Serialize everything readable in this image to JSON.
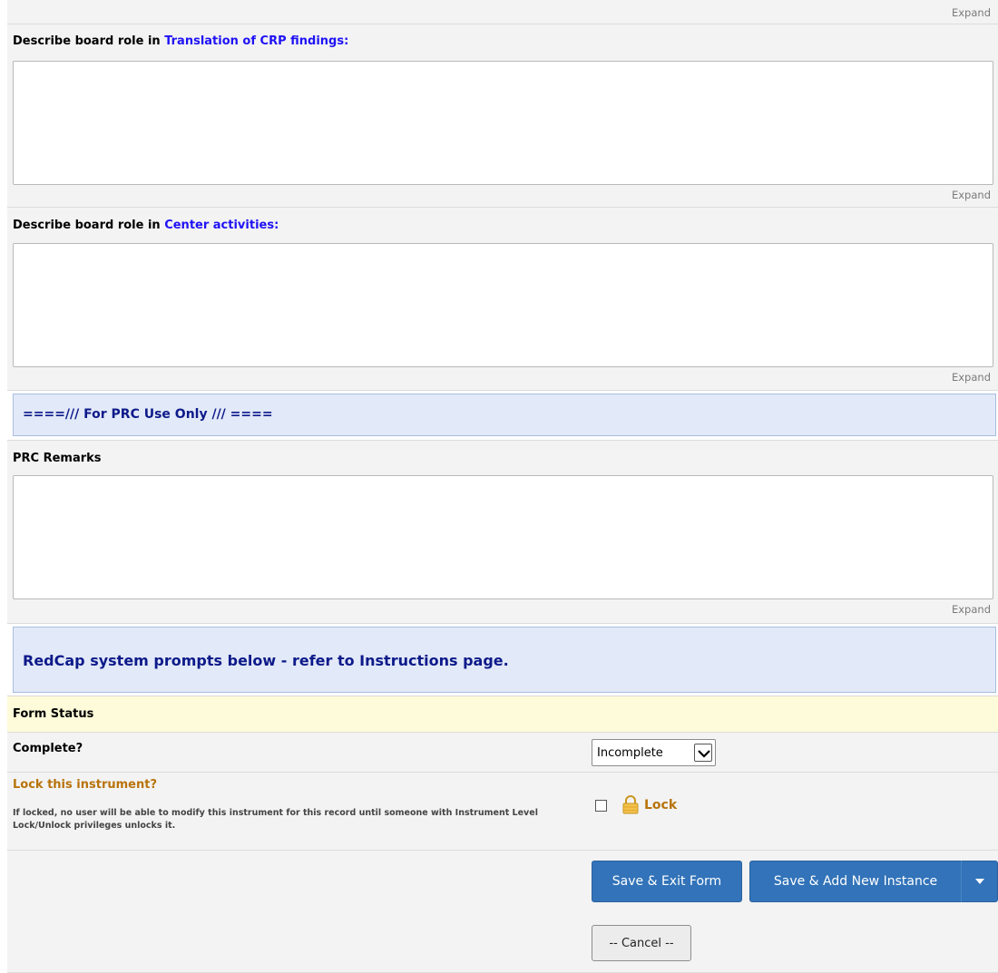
{
  "expand_label": "Expand",
  "fields": {
    "translation_role": {
      "label_prefix": "Describe board role in ",
      "label_highlight": "Translation of CRP findings:",
      "value": ""
    },
    "center_role": {
      "label_prefix": "Describe board role in ",
      "label_highlight": "Center activities:",
      "value": ""
    },
    "prc_remarks": {
      "label": "PRC Remarks",
      "value": ""
    }
  },
  "sections": {
    "prc_header": "====/// For PRC Use Only  /// ====",
    "system_prompts": "RedCap system prompts below - refer to Instructions page."
  },
  "form_status": {
    "header": "Form Status",
    "complete_label": "Complete?",
    "complete_value": "Incomplete"
  },
  "lock": {
    "label": "Lock this instrument?",
    "note": "If locked, no user will be able to modify this instrument for this record until someone with Instrument Level Lock/Unlock privileges unlocks it.",
    "checkbox_label": "Lock"
  },
  "buttons": {
    "save_exit": "Save & Exit Form",
    "save_add": "Save & Add New Instance",
    "cancel": "-- Cancel --"
  },
  "colors": {
    "link_blue": "#1f12f5",
    "section_bg": "#e2e9f8",
    "primary_button": "#3273b9",
    "lock_label": "#b8730b",
    "status_bar": "#fdfbd9"
  }
}
